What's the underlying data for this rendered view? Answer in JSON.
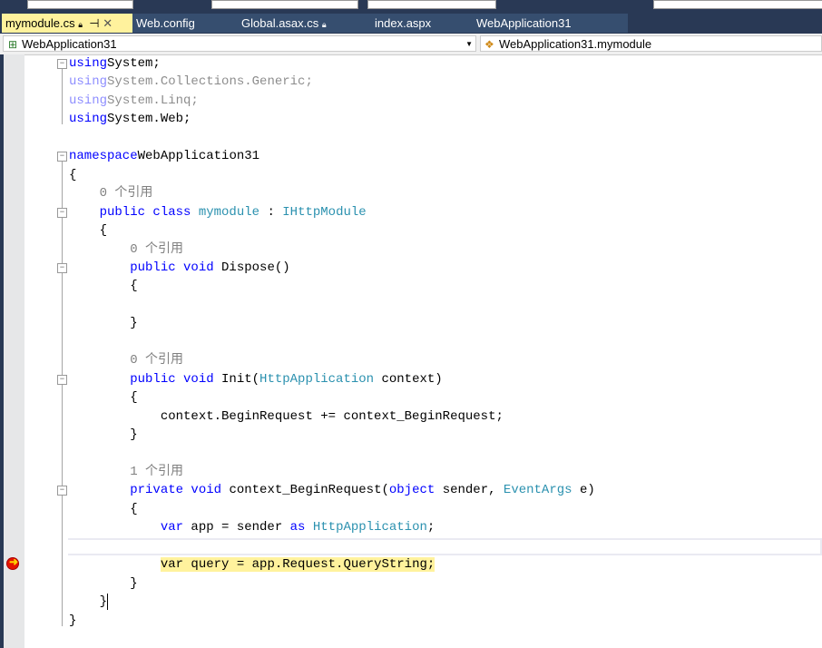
{
  "tabs": [
    {
      "label": "mymodule.cs",
      "active": true,
      "icons": [
        "lock-icon",
        "pin-icon",
        "close-icon"
      ]
    },
    {
      "label": "Web.config"
    },
    {
      "label": "Global.asax.cs",
      "icons": [
        "lock-icon"
      ]
    },
    {
      "label": "index.aspx"
    },
    {
      "label": "WebApplication31"
    }
  ],
  "nav": {
    "project": "WebApplication31",
    "type": "WebApplication31.mymodule"
  },
  "lines": [
    [
      [
        "k",
        "using"
      ],
      [
        "",
        "System;"
      ]
    ],
    [
      [
        "kf",
        "using"
      ],
      [
        "f",
        "System.Collections.Generic;"
      ]
    ],
    [
      [
        "kf",
        "using"
      ],
      [
        "f",
        "System.Linq;"
      ]
    ],
    [
      [
        "k",
        "using"
      ],
      [
        "",
        "System.Web;"
      ]
    ],
    [],
    [
      [
        "k",
        "namespace"
      ],
      [
        "",
        "WebApplication31"
      ]
    ],
    [
      [
        "",
        "{"
      ]
    ],
    [
      [
        "g",
        "    0 个引用"
      ]
    ],
    [
      [
        "k",
        "    public class "
      ],
      [
        "t",
        "mymodule"
      ],
      [
        "",
        " : "
      ],
      [
        "t",
        "IHttpModule"
      ]
    ],
    [
      [
        "",
        "    {"
      ]
    ],
    [
      [
        "g",
        "        0 个引用"
      ]
    ],
    [
      [
        "k",
        "        public void "
      ],
      [
        "",
        "Dispose()"
      ]
    ],
    [
      [
        "",
        "        {"
      ]
    ],
    [],
    [
      [
        "",
        "        }"
      ]
    ],
    [],
    [
      [
        "g",
        "        0 个引用"
      ]
    ],
    [
      [
        "k",
        "        public void "
      ],
      [
        "",
        "Init("
      ],
      [
        "t",
        "HttpApplication"
      ],
      [
        "",
        " context)"
      ]
    ],
    [
      [
        "",
        "        {"
      ]
    ],
    [
      [
        "",
        "            context.BeginRequest += context_BeginRequest;"
      ]
    ],
    [
      [
        "",
        "        }"
      ]
    ],
    [],
    [
      [
        "g",
        "        1 个引用"
      ]
    ],
    [
      [
        "k",
        "        private void "
      ],
      [
        "",
        "context_BeginRequest("
      ],
      [
        "k",
        "object"
      ],
      [
        "",
        " sender, "
      ],
      [
        "t",
        "EventArgs"
      ],
      [
        "",
        " e)"
      ]
    ],
    [
      [
        "",
        "        {"
      ]
    ],
    [
      [
        "k",
        "            var "
      ],
      [
        "",
        "app = sender "
      ],
      [
        "k",
        "as "
      ],
      [
        "t",
        "HttpApplication"
      ],
      [
        "",
        ";"
      ]
    ],
    [],
    [
      [
        "",
        "            "
      ],
      [
        "h",
        "var query = app.Request.QueryString;"
      ]
    ],
    [
      [
        "",
        "        }"
      ]
    ],
    [
      [
        "",
        "    }"
      ]
    ],
    [
      [
        "",
        "}"
      ]
    ]
  ],
  "folds": [
    0,
    5,
    8,
    11,
    17,
    23
  ],
  "breakpoint_line": 27
}
